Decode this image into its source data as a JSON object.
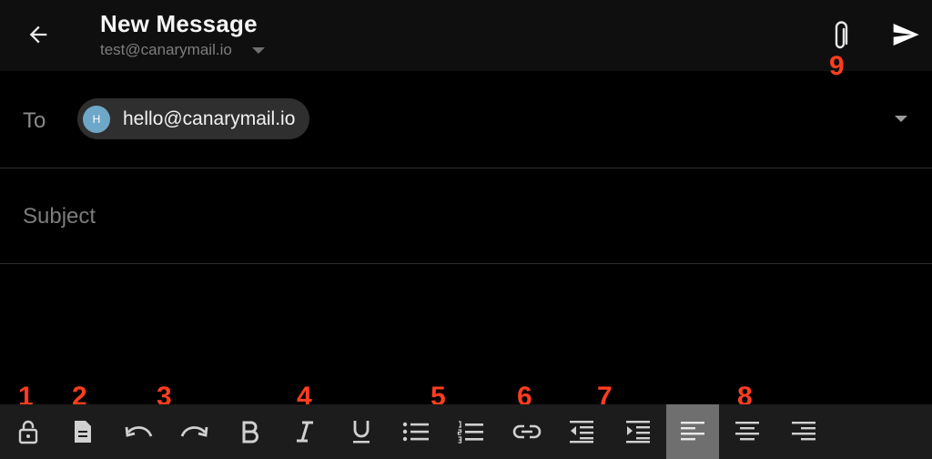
{
  "header": {
    "title": "New Message",
    "from_email": "test@canarymail.io",
    "back_icon": "arrow-left-icon",
    "attach_icon": "paperclip-icon",
    "send_icon": "send-icon"
  },
  "to": {
    "label": "To",
    "recipient_initial": "H",
    "recipient_email": "hello@canarymail.io"
  },
  "subject": {
    "placeholder": "Subject",
    "value": ""
  },
  "toolbar": {
    "icons": [
      "lock-icon",
      "document-icon",
      "undo-icon",
      "redo-icon",
      "bold-icon",
      "italic-icon",
      "underline-icon",
      "bullet-list-icon",
      "numbered-list-icon",
      "link-icon",
      "outdent-icon",
      "indent-icon",
      "align-left-icon",
      "align-center-icon",
      "align-right-icon"
    ],
    "active": "align-left-icon"
  },
  "annotations": {
    "n1": "1",
    "n2": "2",
    "n3": "3",
    "n4": "4",
    "n5": "5",
    "n6": "6",
    "n7": "7",
    "n8": "8",
    "n9": "9"
  },
  "colors": {
    "background": "#000000",
    "header": "#0f0f0f",
    "toolbar": "#1c1c1c",
    "active_button": "#6f6f6f",
    "annotation": "#ff3d1f",
    "avatar": "#6ea7c8"
  }
}
